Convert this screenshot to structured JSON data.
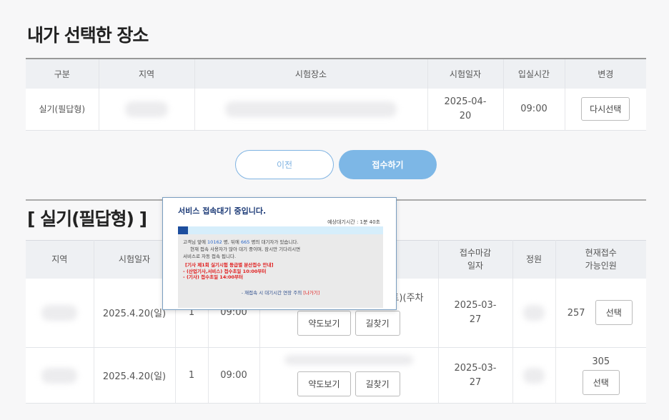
{
  "page_title": "내가 선택한 장소",
  "selected": {
    "headers": [
      "구분",
      "지역",
      "시험장소",
      "시험일자",
      "입실시간",
      "변경"
    ],
    "row": {
      "type": "실기(필답형)",
      "date": "2025-04-20",
      "time": "09:00",
      "reselect_label": "다시선택"
    }
  },
  "actions": {
    "prev_label": "이전",
    "submit_label": "접수하기"
  },
  "section_title": "[ 실기(필답형) ]",
  "list": {
    "headers": {
      "region": "지역",
      "exam_date": "시험일자",
      "deadline": "접수마감\n일자",
      "capacity": "정원",
      "available": "현재접수\n가능인원"
    },
    "rows": [
      {
        "exam_date": "2025.4.20(일)",
        "session": "1",
        "time": "09:00",
        "place_suffix": "트)(주차",
        "deadline": "2025-03-27",
        "available": "257",
        "map_label": "약도보기",
        "route_label": "길찾기",
        "select_label": "선택"
      },
      {
        "exam_date": "2025.4.20(일)",
        "session": "1",
        "time": "09:00",
        "place_suffix": "",
        "deadline": "2025-03-27",
        "available": "305",
        "map_label": "약도보기",
        "route_label": "길찾기",
        "select_label": "선택"
      }
    ]
  },
  "popup": {
    "title": "서비스 접속대기 중입니다.",
    "wait_label": "예상대기시간 : 1분 40초",
    "progress": 0.05,
    "line1_pre": "고객님 앞에 ",
    "ahead": "10162",
    "line1_mid": " 명, 뒤에 ",
    "behind": "665",
    "line1_post": " 명의 대기자가 있습니다.",
    "line2": "현재 접속 사용자가 많아 대기 중이며, 잠시만 기다리시면",
    "line3": "서비스로 자동 접속 됩니다.",
    "notice_title": "[기사 제1회 실기시험 등급별 분산접수 안내]",
    "notice_1": "- (산업기사,서비스) 접수초일 10:00부터",
    "notice_2": "- (기사) 접수초일 14:00부터",
    "retry_text": "- 재접속 시 대기시간 연장 주의 ",
    "exit_label": "[나가기]"
  },
  "colors": {
    "accent": "#7db7e6",
    "popup_title": "#1e3c78",
    "progress": "#1d4e9e",
    "notice": "#e01b1b"
  }
}
